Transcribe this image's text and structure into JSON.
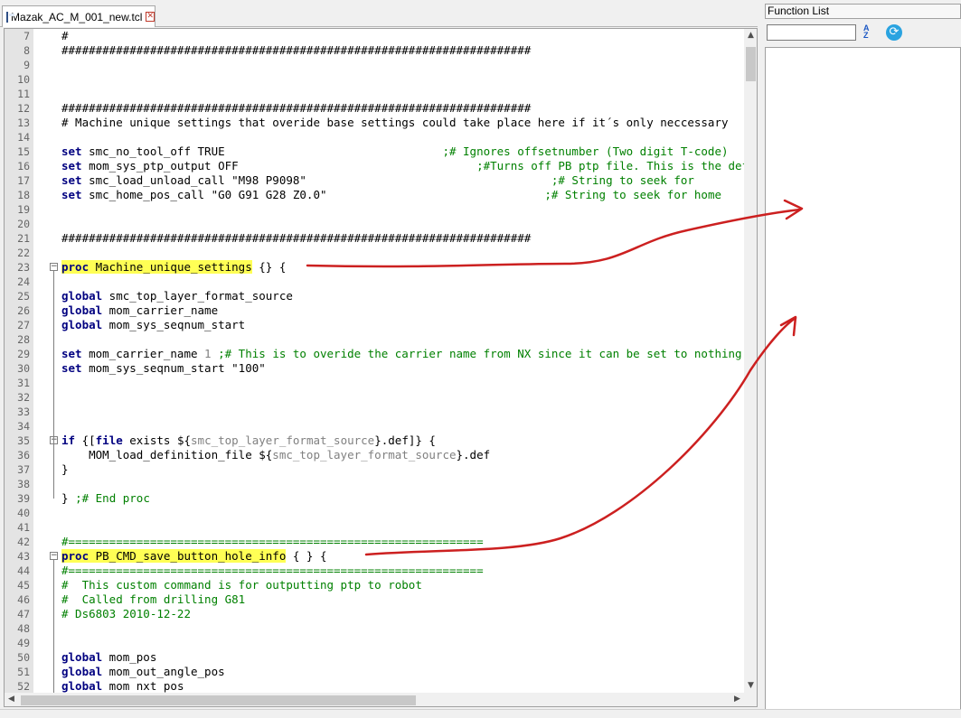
{
  "tab": {
    "filename": "Mazak_AC_M_001_new.tcl",
    "close_glyph": "✕",
    "icon": "file-save-icon"
  },
  "function_list": {
    "title": "Function List",
    "search_value": "",
    "sort_glyph": "A\nZ",
    "sort_icon": "sort-az-icon",
    "refresh_glyph": "⟳",
    "refresh_icon": "refresh-icon"
  },
  "scroll": {
    "up": "▲",
    "down": "▼",
    "left": "◀",
    "right": "▶"
  },
  "colors": {
    "keyword": "#000080",
    "comment": "#008000",
    "highlight": "#ffff55",
    "annotation": "#cc2020"
  },
  "lines": [
    {
      "n": "7",
      "t": [
        [
          "#",
          ""
        ]
      ]
    },
    {
      "n": "8",
      "t": [
        [
          "#####################################################################",
          ""
        ]
      ]
    },
    {
      "n": "9",
      "t": []
    },
    {
      "n": "10",
      "t": []
    },
    {
      "n": "11",
      "t": []
    },
    {
      "n": "12",
      "t": [
        [
          "#####################################################################",
          ""
        ]
      ]
    },
    {
      "n": "13",
      "t": [
        [
          "# Machine unique settings that overide base settings could take place here if it´s only neccessary",
          ""
        ]
      ]
    },
    {
      "n": "14",
      "t": []
    },
    {
      "n": "15",
      "t": [
        [
          "set",
          "kw"
        ],
        [
          " smc_no_tool_off TRUE                                ",
          ""
        ],
        [
          ";# Ignores offsetnumber (Two digit T-code)",
          "cm"
        ]
      ]
    },
    {
      "n": "16",
      "t": [
        [
          "set",
          "kw"
        ],
        [
          " mom_sys_ptp_output OFF                                   ",
          ""
        ],
        [
          ";#Turns off PB ptp file. This is the default",
          "cm"
        ]
      ]
    },
    {
      "n": "17",
      "t": [
        [
          "set",
          "kw"
        ],
        [
          " smc_load_unload_call \"M98 P9098\"                                    ",
          ""
        ],
        [
          ";# String to seek for",
          "cm"
        ]
      ]
    },
    {
      "n": "18",
      "t": [
        [
          "set",
          "kw"
        ],
        [
          " smc_home_pos_call \"G0 G91 G28 Z0.0\"                                ",
          ""
        ],
        [
          ";# String to seek for home",
          "cm"
        ]
      ]
    },
    {
      "n": "19",
      "t": []
    },
    {
      "n": "20",
      "t": []
    },
    {
      "n": "21",
      "t": [
        [
          "#####################################################################",
          ""
        ]
      ]
    },
    {
      "n": "22",
      "t": []
    },
    {
      "n": "23",
      "t": [
        [
          "proc",
          "kw hl"
        ],
        [
          " Machine_unique_settings",
          "hl"
        ],
        [
          " {} {",
          ""
        ]
      ]
    },
    {
      "n": "24",
      "t": []
    },
    {
      "n": "25",
      "t": [
        [
          "global",
          "kw"
        ],
        [
          " smc_top_layer_format_source",
          ""
        ]
      ]
    },
    {
      "n": "26",
      "t": [
        [
          "global",
          "kw"
        ],
        [
          " mom_carrier_name",
          ""
        ]
      ]
    },
    {
      "n": "27",
      "t": [
        [
          "global",
          "kw"
        ],
        [
          " mom_sys_seqnum_start",
          ""
        ]
      ]
    },
    {
      "n": "28",
      "t": []
    },
    {
      "n": "29",
      "t": [
        [
          "set",
          "kw"
        ],
        [
          " mom_carrier_name ",
          ""
        ],
        [
          "1",
          "st"
        ],
        [
          " ",
          ""
        ],
        [
          ";# This is to overide the carrier name from NX since it can be set to nothing",
          "cm"
        ]
      ]
    },
    {
      "n": "30",
      "t": [
        [
          "set",
          "kw"
        ],
        [
          " mom_sys_seqnum_start \"100\"",
          ""
        ]
      ]
    },
    {
      "n": "31",
      "t": []
    },
    {
      "n": "32",
      "t": []
    },
    {
      "n": "33",
      "t": []
    },
    {
      "n": "34",
      "t": []
    },
    {
      "n": "35",
      "t": [
        [
          "if",
          "kw"
        ],
        [
          " {[",
          ""
        ],
        [
          "file",
          "kw"
        ],
        [
          " exists ${",
          ""
        ],
        [
          "smc_top_layer_format_source",
          "st"
        ],
        [
          "}.def]} {",
          ""
        ]
      ]
    },
    {
      "n": "36",
      "t": [
        [
          "    MOM_load_definition_file ${",
          ""
        ],
        [
          "smc_top_layer_format_source",
          "st"
        ],
        [
          "}.def",
          ""
        ]
      ]
    },
    {
      "n": "37",
      "t": [
        [
          "}",
          ""
        ]
      ]
    },
    {
      "n": "38",
      "t": []
    },
    {
      "n": "39",
      "t": [
        [
          "} ",
          ""
        ],
        [
          ";# End proc",
          "cm"
        ]
      ]
    },
    {
      "n": "40",
      "t": []
    },
    {
      "n": "41",
      "t": []
    },
    {
      "n": "42",
      "t": [
        [
          "#=============================================================",
          "cm"
        ]
      ]
    },
    {
      "n": "43",
      "t": [
        [
          "proc",
          "kw hl"
        ],
        [
          " PB_CMD_save_button_hole_info",
          "hl"
        ],
        [
          " { } {",
          ""
        ]
      ]
    },
    {
      "n": "44",
      "t": [
        [
          "#=============================================================",
          "cm"
        ]
      ]
    },
    {
      "n": "45",
      "t": [
        [
          "#  This custom command is for outputting ptp to robot",
          "cm"
        ]
      ]
    },
    {
      "n": "46",
      "t": [
        [
          "#  Called from drilling G81",
          "cm"
        ]
      ]
    },
    {
      "n": "47",
      "t": [
        [
          "# Ds6803 2010-12-22",
          "cm"
        ]
      ]
    },
    {
      "n": "48",
      "t": []
    },
    {
      "n": "49",
      "t": []
    },
    {
      "n": "50",
      "t": [
        [
          "global",
          "kw"
        ],
        [
          " mom_pos",
          ""
        ]
      ]
    },
    {
      "n": "51",
      "t": [
        [
          "global",
          "kw"
        ],
        [
          " mom_out_angle_pos",
          ""
        ]
      ]
    },
    {
      "n": "52",
      "t": [
        [
          "global",
          "kw"
        ],
        [
          " mom nxt pos",
          ""
        ]
      ]
    }
  ]
}
